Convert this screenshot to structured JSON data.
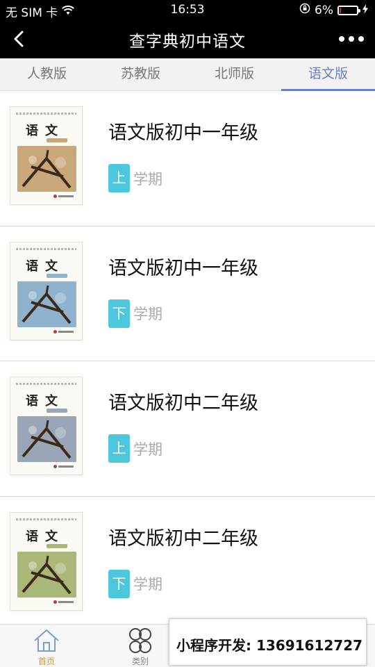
{
  "status_bar": {
    "carrier": "无 SIM 卡",
    "time": "16:53",
    "battery_percent": "6%",
    "battery_level": 0.06
  },
  "nav": {
    "title": "查字典初中语文"
  },
  "tabs": [
    {
      "label": "人教版",
      "active": false
    },
    {
      "label": "苏教版",
      "active": false
    },
    {
      "label": "北师版",
      "active": false
    },
    {
      "label": "语文版",
      "active": true
    }
  ],
  "books": [
    {
      "name": "语文版初中一年级",
      "term": "上",
      "term_suffix": "学期",
      "cover_title": "语文",
      "cover_color": "#c9a77a"
    },
    {
      "name": "语文版初中一年级",
      "term": "下",
      "term_suffix": "学期",
      "cover_title": "语文",
      "cover_color": "#8fb3cc"
    },
    {
      "name": "语文版初中二年级",
      "term": "上",
      "term_suffix": "学期",
      "cover_title": "语文",
      "cover_color": "#9aa6b8"
    },
    {
      "name": "语文版初中二年级",
      "term": "下",
      "term_suffix": "学期",
      "cover_title": "语文",
      "cover_color": "#a9b878"
    }
  ],
  "tabbar": {
    "home_label": "首页",
    "category_label": "类别"
  },
  "ad": {
    "text": "小程序开发: 13691612727"
  },
  "colors": {
    "accent": "#6a7fc8",
    "badge": "#4cc7dc",
    "active_tab_bar": "#d19a3a"
  }
}
